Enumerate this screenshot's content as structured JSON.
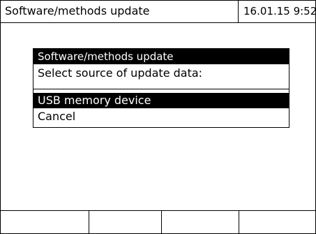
{
  "header": {
    "title": "Software/methods update",
    "date_time": "16.01.15  9:52"
  },
  "dialog": {
    "title": "Software/methods update",
    "prompt": "Select source of update data:",
    "options": [
      {
        "label": "USB memory device",
        "selected": true
      },
      {
        "label": "Cancel",
        "selected": false
      }
    ]
  },
  "softkeys": [
    "",
    "",
    "",
    ""
  ]
}
